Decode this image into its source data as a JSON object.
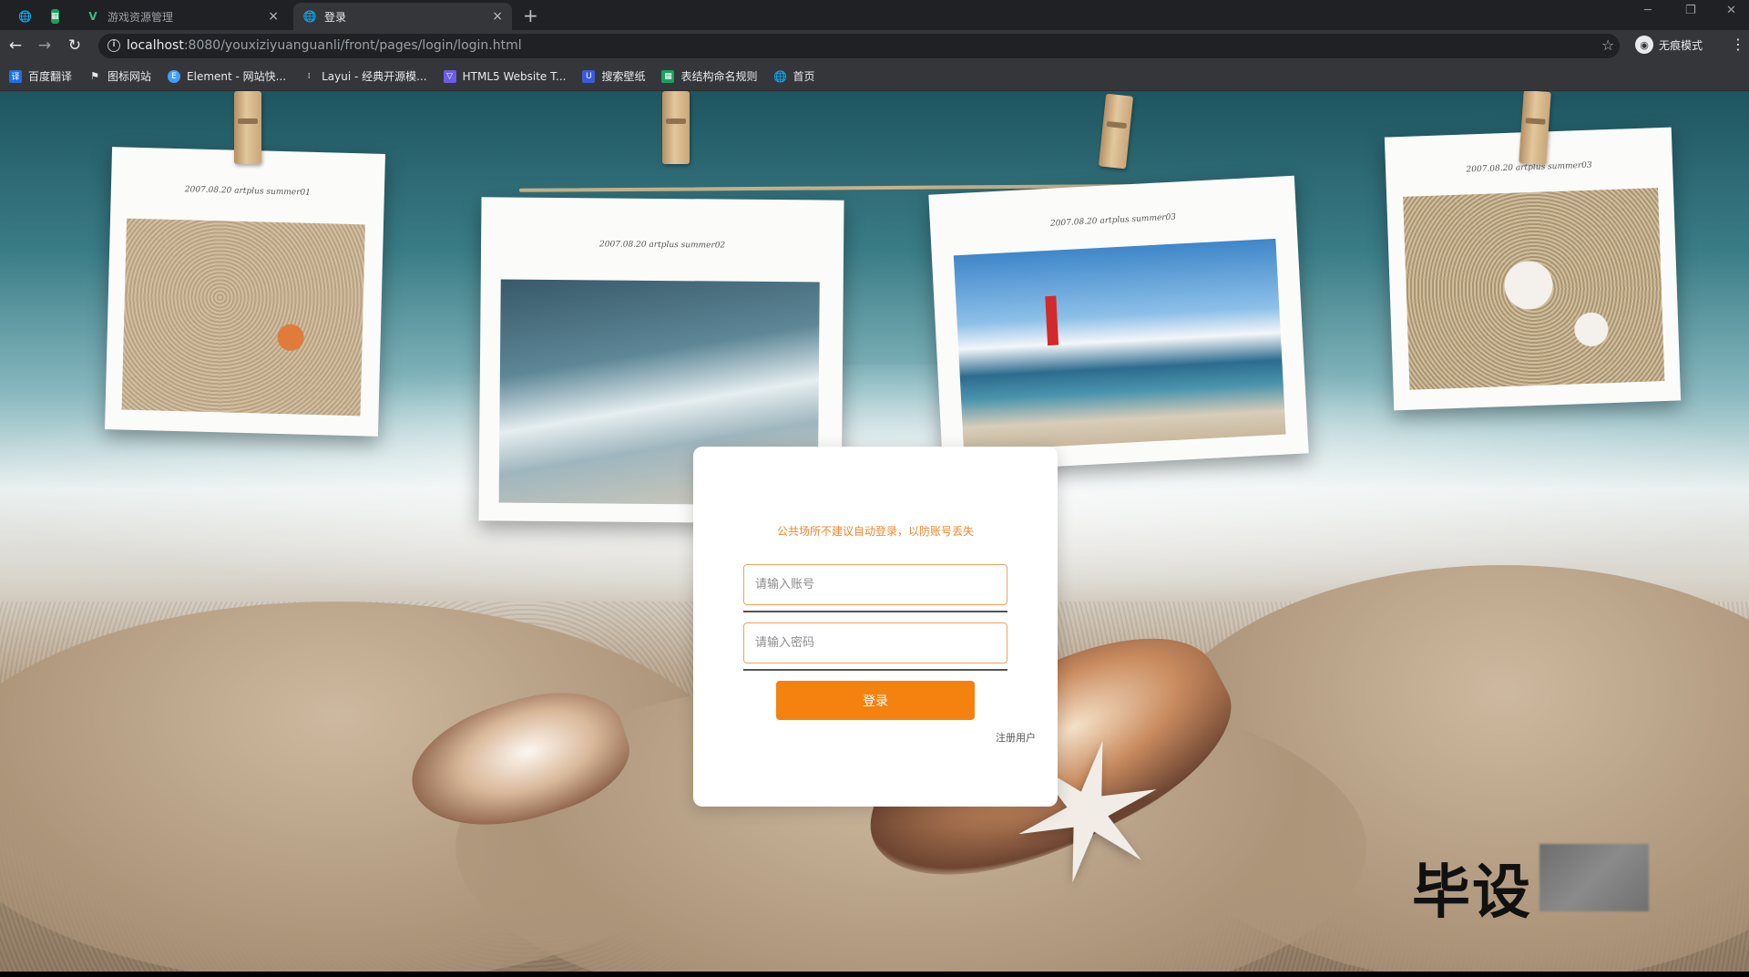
{
  "browser": {
    "tabs": [
      {
        "label": "",
        "icon": "globe-icon"
      },
      {
        "label": "",
        "icon": "green-app-icon"
      },
      {
        "label": "游戏资源管理",
        "icon": "vue-icon",
        "close": "×"
      },
      {
        "label": "登录",
        "icon": "globe-icon",
        "close": "×",
        "active": true
      }
    ],
    "new_tab": "+",
    "url_host": "localhost",
    "url_path": ":8080/youxiziyuanguanli/front/pages/login/login.html",
    "profile_label": "无痕模式",
    "bookmarks": [
      {
        "label": "百度翻译",
        "icon": "baidu-translate-icon",
        "color": "#1f6fe5"
      },
      {
        "label": "图标网站",
        "icon": "flag-icon",
        "color": "#444444"
      },
      {
        "label": "Element - 网站快...",
        "icon": "element-icon",
        "color": "#409eff"
      },
      {
        "label": "Layui - 经典开源模...",
        "icon": "layui-icon",
        "color": "#444444"
      },
      {
        "label": "HTML5 Website T...",
        "icon": "html5-template-icon",
        "color": "#6c5ce7"
      },
      {
        "label": "搜索壁纸",
        "icon": "wallpaper-icon",
        "color": "#3b5bdb"
      },
      {
        "label": "表结构命名规则",
        "icon": "sheet-icon",
        "color": "#1aa260"
      },
      {
        "label": "首页",
        "icon": "globe-icon",
        "color": "#555555"
      }
    ]
  },
  "photos": [
    {
      "caption": "2007.08.20 artplus summer01",
      "scene": "starfish"
    },
    {
      "caption": "2007.08.20 artplus summer02",
      "scene": "wave"
    },
    {
      "caption": "2007.08.20 artplus summer03",
      "scene": "lighthouse"
    },
    {
      "caption": "2007.08.20 artplus summer03",
      "scene": "shells"
    }
  ],
  "login": {
    "notice": "公共场所不建议自动登录，以防账号丢失",
    "account_placeholder": "请输入账号",
    "account_value": "",
    "password_placeholder": "请输入密码",
    "password_value": "",
    "submit_label": "登录",
    "register_label": "注册用户"
  },
  "watermark": {
    "text": "毕设"
  },
  "colors": {
    "accent": "#f5810f",
    "notice": "#f0862b",
    "input_border": "#f4a15c"
  }
}
